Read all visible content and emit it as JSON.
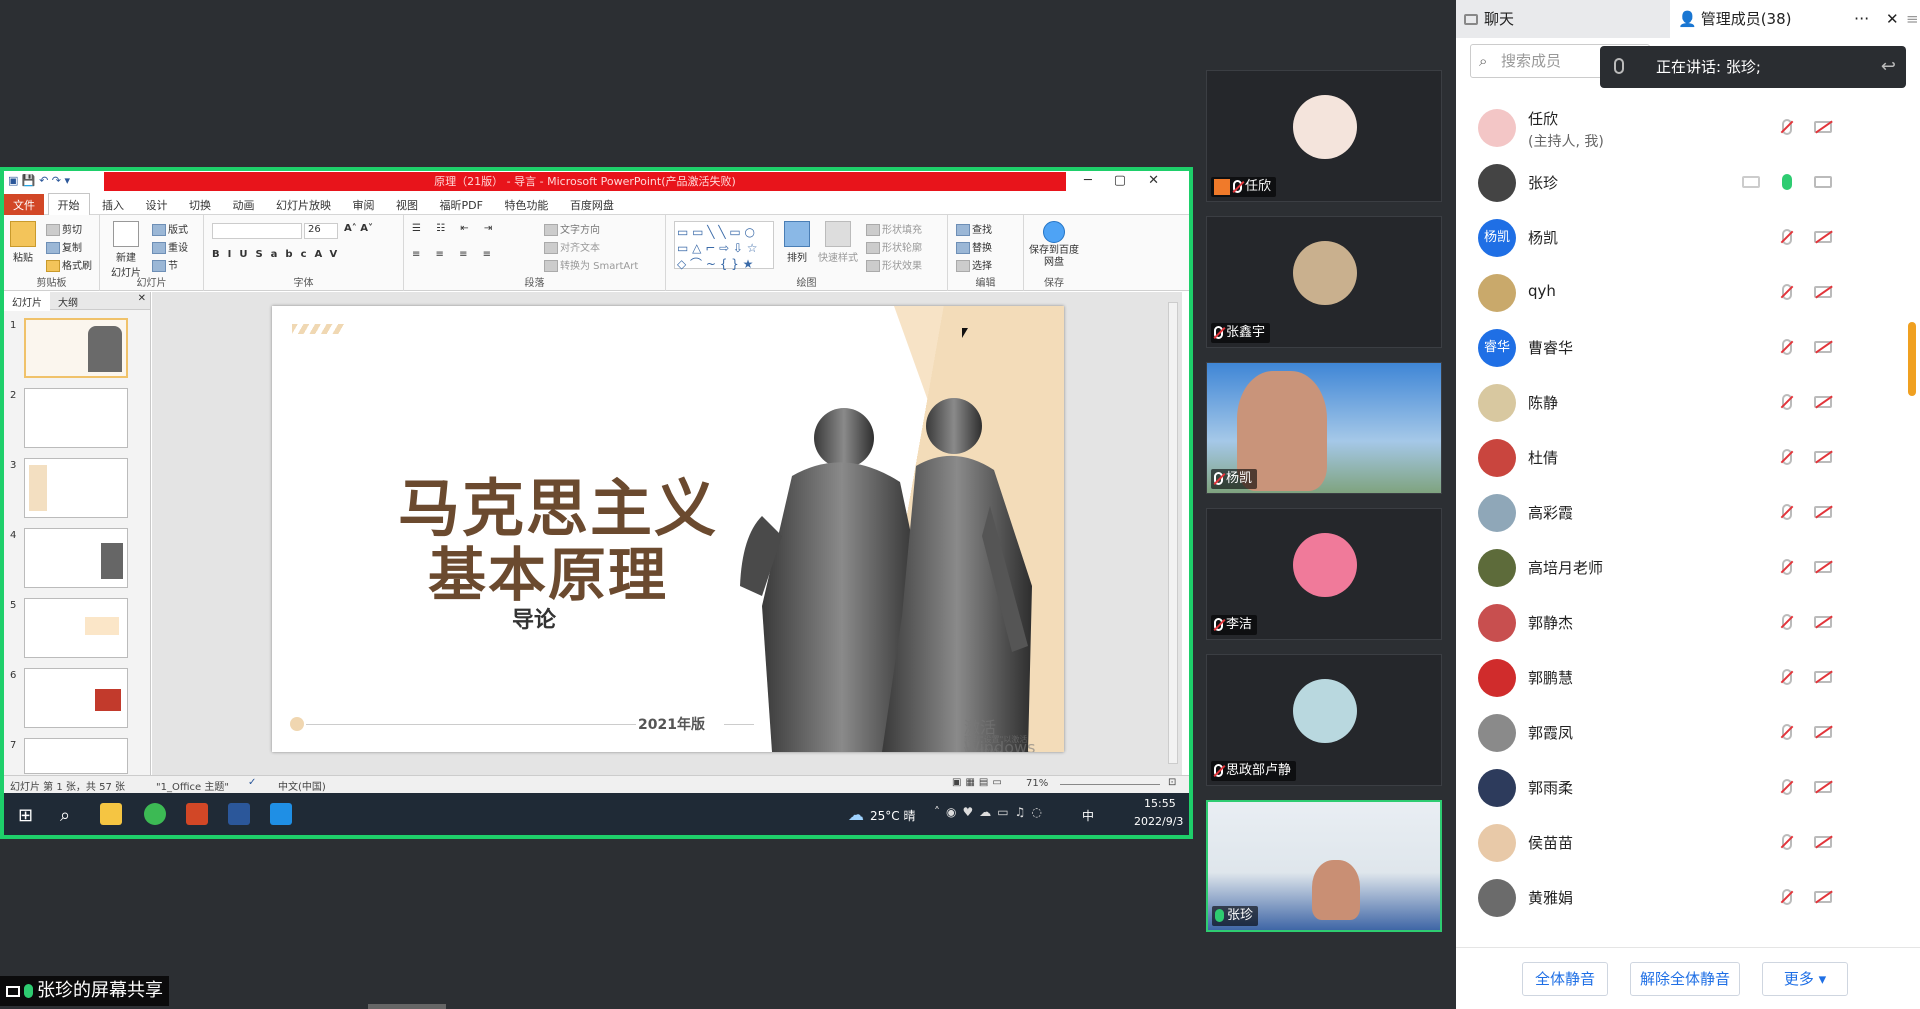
{
  "ppt": {
    "title": "原理（21版） - 导言 - Microsoft PowerPoint(产品激活失败)",
    "menus": [
      "文件",
      "开始",
      "插入",
      "设计",
      "切换",
      "动画",
      "幻灯片放映",
      "审阅",
      "视图",
      "福昕PDF",
      "特色功能",
      "百度网盘"
    ],
    "ribbon": {
      "clipboard": {
        "paste": "粘贴",
        "cut": "剪切",
        "copy": "复制",
        "format": "格式刷",
        "label": "剪贴板"
      },
      "slides": {
        "new": "新建\n幻灯片",
        "layout": "版式",
        "reset": "重设",
        "section": "节",
        "label": "幻灯片"
      },
      "font": {
        "size": "26",
        "label": "字体"
      },
      "paragraph": {
        "direction": "文字方向",
        "align": "对齐文本",
        "smartart": "转换为 SmartArt",
        "label": "段落"
      },
      "drawing": {
        "arrange": "排列",
        "quickstyle": "快速样式",
        "fill": "形状填充",
        "outline": "形状轮廓",
        "effect": "形状效果",
        "label": "绘图"
      },
      "edit": {
        "find": "查找",
        "replace": "替换",
        "select": "选择",
        "label": "编辑"
      },
      "save": {
        "baidu": "保存到百度网盘",
        "label": "保存"
      }
    },
    "pane_tabs": [
      "幻灯片",
      "大纲"
    ],
    "thumb_numbers": [
      "1",
      "2",
      "3",
      "4",
      "5",
      "6",
      "7"
    ],
    "slide": {
      "title_line1": "马克思主义",
      "title_line2": "基本原理",
      "subtitle": "导论",
      "year": "2021年版",
      "watermark": "激活 Windows",
      "watermark_sub": "转到\"设置\"以激活 Windows。"
    },
    "status": {
      "slide": "幻灯片 第 1 张，共 57 张",
      "theme": "\"1_Office 主题\"",
      "lang": "中文(中国)",
      "zoom": "71%"
    },
    "taskbar": {
      "weather": "25°C 晴",
      "ime": "中",
      "time": "15:55",
      "date": "2022/9/3"
    }
  },
  "videos": [
    {
      "name": "任欣",
      "host": true
    },
    {
      "name": "张鑫宇"
    },
    {
      "name": "杨凯"
    },
    {
      "name": "李洁"
    },
    {
      "name": "思政部卢静"
    },
    {
      "name": "张珍",
      "speaking": true
    }
  ],
  "panel": {
    "tab_chat": "聊天",
    "tab_members": "管理成员(38)",
    "more": "···",
    "close": "✕",
    "search_placeholder": "搜索成员",
    "speaking": "正在讲话: 张珍;",
    "members": [
      {
        "name": "任欣",
        "sub": "(主持人, 我)",
        "avatar": "",
        "color": "#f3c6c6"
      },
      {
        "name": "张珍",
        "avatar": "",
        "color": "#444",
        "mic": "on"
      },
      {
        "name": "杨凯",
        "avatar": "杨凯",
        "color": "#1f6fe5"
      },
      {
        "name": "qyh",
        "avatar": "",
        "color": "#c9a96b"
      },
      {
        "name": "曹睿华",
        "avatar": "睿华",
        "color": "#1f6fe5"
      },
      {
        "name": "陈静",
        "avatar": "",
        "color": "#d8c8a0"
      },
      {
        "name": "杜倩",
        "avatar": "",
        "color": "#c9453e"
      },
      {
        "name": "高彩霞",
        "avatar": "",
        "color": "#8fa7b8"
      },
      {
        "name": "高培月老师",
        "avatar": "",
        "color": "#5d6b3a"
      },
      {
        "name": "郭静杰",
        "avatar": "",
        "color": "#c84f4f"
      },
      {
        "name": "郭鹏慧",
        "avatar": "",
        "color": "#d02c2c"
      },
      {
        "name": "郭霞凤",
        "avatar": "",
        "color": "#8a8a8a"
      },
      {
        "name": "郭雨柔",
        "avatar": "",
        "color": "#2d3b5c"
      },
      {
        "name": "侯苗苗",
        "avatar": "",
        "color": "#e8c9a8"
      },
      {
        "name": "黄雅娟",
        "avatar": "",
        "color": "#6b6b6b"
      }
    ],
    "btn_mute_all": "全体静音",
    "btn_unmute_all": "解除全体静音",
    "btn_more": "更多 ▾"
  },
  "share_label": "张珍的屏幕共享"
}
